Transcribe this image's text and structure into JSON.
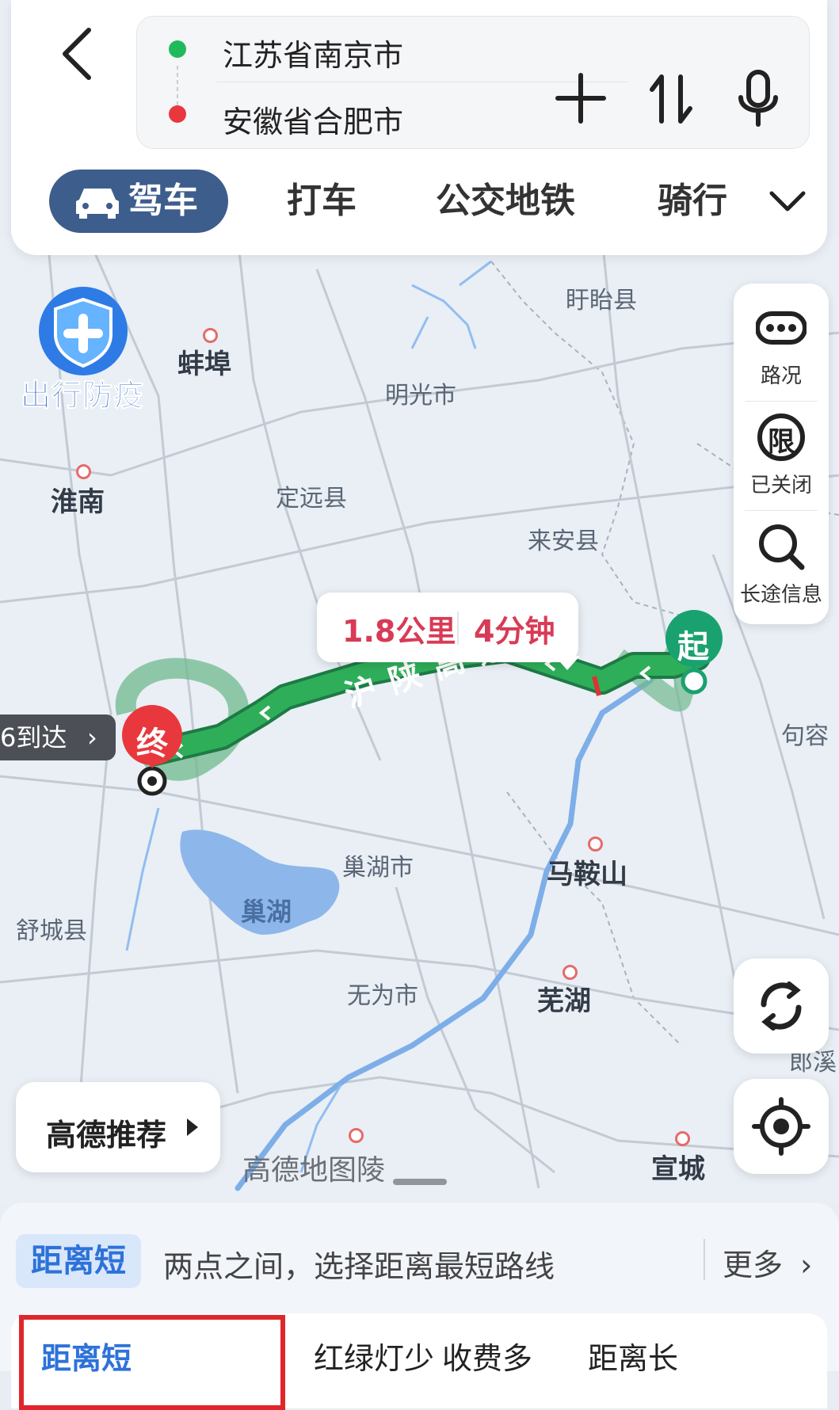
{
  "header": {
    "origin": "江苏省南京市",
    "destination": "安徽省合肥市",
    "modes": [
      "驾车",
      "打车",
      "公交地铁",
      "骑行"
    ]
  },
  "map": {
    "cities": [
      "蚌埠",
      "淮南",
      "马鞍山",
      "芜湖",
      "宣城"
    ],
    "towns": [
      "盱眙县",
      "明光市",
      "定远县",
      "来安县",
      "句容",
      "巢湖市",
      "舒城县",
      "无为市"
    ],
    "lake": "巢湖",
    "highway": "沪陕高速",
    "start_marker": "起",
    "end_marker": "终",
    "bubble_distance": "1.8公里",
    "bubble_time": "4分钟",
    "arrive_tag": "6到达",
    "watermark": "高德地图",
    "partial_labels": [
      "郎溪",
      "陵"
    ]
  },
  "promo": {
    "label": "出行防疫"
  },
  "tools": [
    {
      "label": "路况",
      "icon": "traffic-icon"
    },
    {
      "label": "已关闭",
      "icon": "restriction-icon",
      "glyph": "限"
    },
    {
      "label": "长途信息",
      "icon": "search-icon"
    }
  ],
  "recommend": {
    "label": "高德推荐"
  },
  "sheet": {
    "pref_badge": "距离短",
    "pref_desc": "两点之间，选择距离最短路线",
    "more": "更多",
    "options": [
      "距离短",
      "红绿灯少",
      "收费多",
      "距离长"
    ]
  },
  "colors": {
    "route_green": "#1e9a4c",
    "end_red": "#e8383d",
    "start_green": "#1aa170",
    "accent_blue": "#2d72d9",
    "mode_active_bg": "#3d5d8c"
  }
}
